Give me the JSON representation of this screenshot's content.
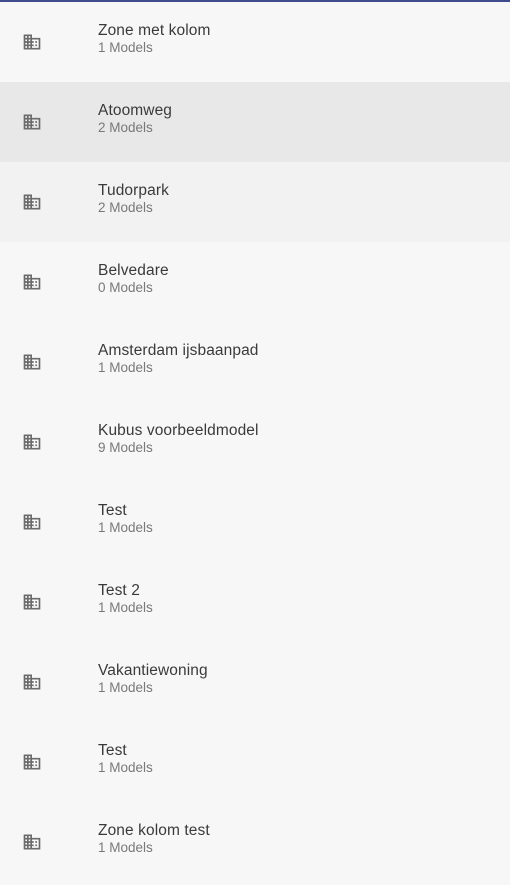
{
  "projects": {
    "items": [
      {
        "name": "Zone met kolom",
        "count": "1 Models"
      },
      {
        "name": "Atoomweg",
        "count": "2 Models"
      },
      {
        "name": "Tudorpark",
        "count": "2 Models"
      },
      {
        "name": "Belvedare",
        "count": "0 Models"
      },
      {
        "name": "Amsterdam ijsbaanpad",
        "count": "1 Models"
      },
      {
        "name": "Kubus voorbeeldmodel",
        "count": "9 Models"
      },
      {
        "name": "Test",
        "count": "1 Models"
      },
      {
        "name": "Test 2",
        "count": "1 Models"
      },
      {
        "name": "Vakantiewoning",
        "count": "1 Models"
      },
      {
        "name": "Test",
        "count": "1 Models"
      },
      {
        "name": "Zone kolom test",
        "count": "1 Models"
      }
    ],
    "icon": "building-icon",
    "colors": {
      "accent_top_border": "#3f4b8c",
      "hover_bg": "#e8e8e8",
      "selected_bg": "#f2f2f2",
      "icon": "#6b6b6b"
    }
  }
}
